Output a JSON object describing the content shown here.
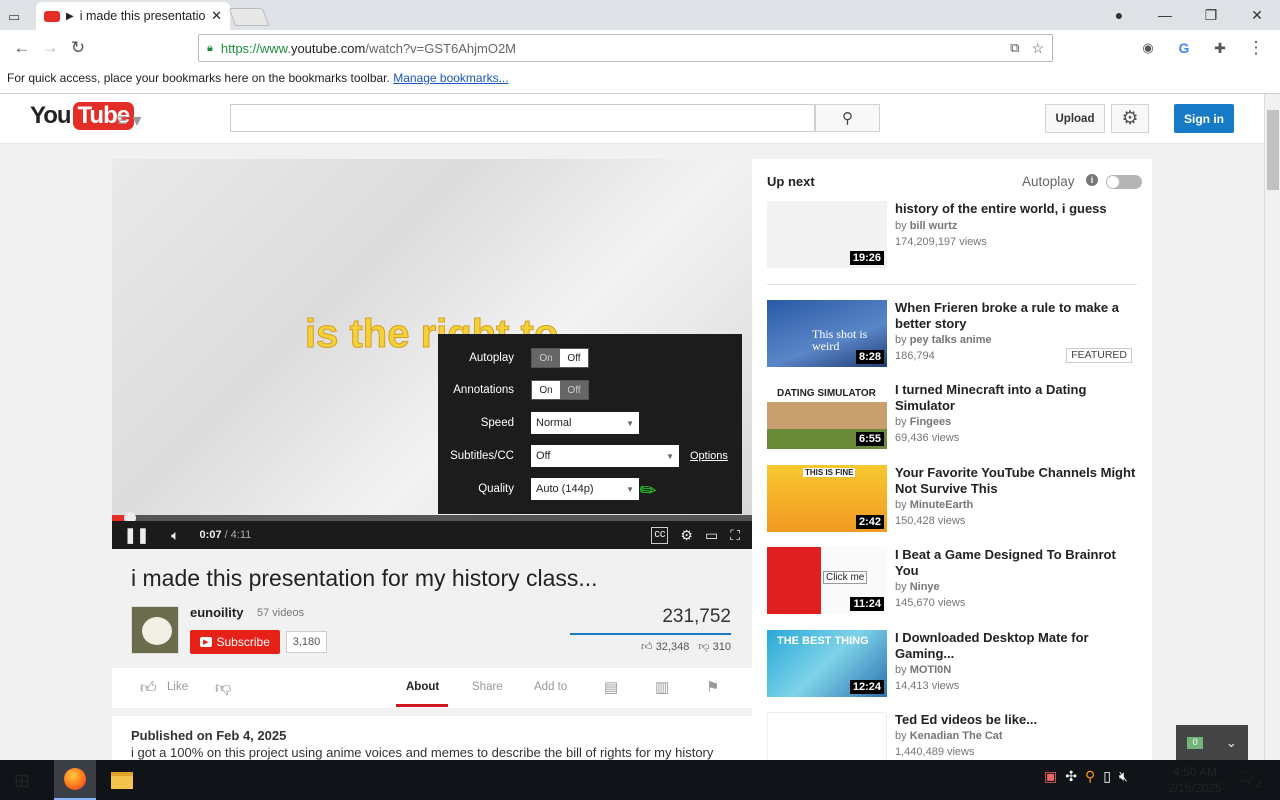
{
  "browser": {
    "tab_title": "i made this presentation",
    "url_prefix": "https://www.",
    "url_domain": "youtube.com",
    "url_path": "/watch?v=GST6AhjmO2M",
    "bookmarks_text": "For quick access, place your bookmarks here on the bookmarks toolbar.",
    "bookmarks_link": "Manage bookmarks..."
  },
  "header": {
    "logo_you": "You",
    "logo_tube": "Tube",
    "upload_label": "Upload",
    "signin_label": "Sign in"
  },
  "player": {
    "caption_text": "is the right to",
    "progress_fraction": 0.028,
    "time_current": "0:07",
    "time_total": "4:11",
    "settings": {
      "autoplay_label": "Autoplay",
      "autoplay_on": "On",
      "autoplay_off": "Off",
      "annotations_label": "Annotations",
      "annotations_on": "On",
      "annotations_off": "Off",
      "speed_label": "Speed",
      "speed_value": "Normal",
      "subtitles_label": "Subtitles/CC",
      "subtitles_value": "Off",
      "options_label": "Options",
      "quality_label": "Quality",
      "quality_value": "Auto (144p)"
    }
  },
  "video": {
    "title": "i made this presentation for my history class...",
    "channel": "eunoility",
    "channel_videos": "57 videos",
    "subscribe_label": "Subscribe",
    "subscriber_count": "3,180",
    "view_count": "231,752",
    "likes": "32,348",
    "dislikes": "310",
    "like_label": "Like",
    "tabs": {
      "about": "About",
      "share": "Share",
      "addto": "Add to"
    },
    "published": "Published on Feb 4, 2025",
    "description": "i got a 100% on this project using anime voices and memes to describe the bill of rights for my history"
  },
  "sidebar": {
    "upnext": "Up next",
    "autoplay": "Autoplay",
    "items": [
      {
        "title": "history of the entire world, i guess",
        "by": "by",
        "channel": "bill wurtz",
        "views": "174,209,197 views",
        "duration": "19:26"
      },
      {
        "title": "When Frieren broke a rule to make a better story",
        "by": "by",
        "channel": "pey talks anime",
        "views": "186,794",
        "duration": "8:28",
        "badge": "FEATURED"
      },
      {
        "title": "I turned Minecraft into a Dating Simulator",
        "by": "by",
        "channel": "Fingees",
        "views": "69,436 views",
        "duration": "6:55"
      },
      {
        "title": "Your Favorite YouTube Channels Might Not Survive This",
        "by": "by",
        "channel": "MinuteEarth",
        "views": "150,428 views",
        "duration": "2:42"
      },
      {
        "title": "I Beat a Game Designed To Brainrot You",
        "by": "by",
        "channel": "Ninye",
        "views": "145,670 views",
        "duration": "11:24"
      },
      {
        "title": "I Downloaded Desktop Mate for Gaming...",
        "by": "by",
        "channel": "MOTI0N",
        "views": "14,413 views",
        "duration": "12:24"
      },
      {
        "title": "Ted Ed videos be like...",
        "by": "by",
        "channel": "Kenadian The Cat",
        "views": "1,440,489 views",
        "duration": ""
      }
    ],
    "thumb_texts": {
      "frieren": "This shot is weird",
      "dating": "DATING SIMULATOR",
      "fine": "THIS IS FINE",
      "clickme": "Click me",
      "bestthing": "THE BEST THING"
    }
  },
  "notif": {
    "count": "0"
  },
  "taskbar": {
    "time": "4:50 AM",
    "date": "2/15/2025",
    "notifications": "2"
  }
}
